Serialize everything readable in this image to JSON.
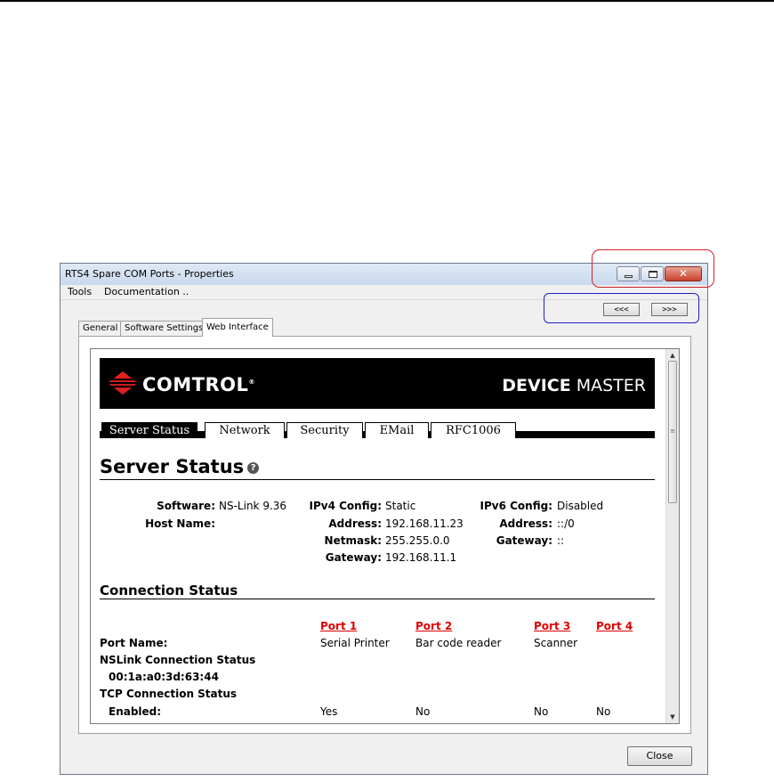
{
  "window": {
    "title": "RTS4 Spare COM Ports - Properties",
    "close_glyph": "✕"
  },
  "menu": {
    "items": [
      "Tools",
      "Documentation .."
    ]
  },
  "nav": {
    "back_label": "<<<",
    "forward_label": ">>>"
  },
  "tabs": [
    "General",
    "Software Settings",
    "Web Interface"
  ],
  "active_tab": "Web Interface",
  "web": {
    "brand": "COMTROL",
    "brand_mark": "®",
    "product_bold": "DEVICE",
    "product_rest": "MASTER",
    "tabs": [
      "Server Status",
      "Network",
      "Security",
      "EMail",
      "RFC1006"
    ],
    "active_tab": "Server Status",
    "server_status": {
      "heading": "Server Status",
      "help_glyph": "?",
      "software_label": "Software:",
      "software_value": "NS-Link 9.36",
      "host_label": "Host Name:",
      "ipv4_label": "IPv4 Config:",
      "ipv4_value": "Static",
      "address_label": "Address:",
      "address_value": "192.168.11.23",
      "netmask_label": "Netmask:",
      "netmask_value": "255.255.0.0",
      "gateway_label": "Gateway:",
      "gateway_value": "192.168.11.1",
      "ipv6_label": "IPv6 Config:",
      "ipv6_value": "Disabled",
      "ipv6_address_label": "Address:",
      "ipv6_address_value": "::/0",
      "ipv6_gateway_label": "Gateway:",
      "ipv6_gateway_value": "::"
    },
    "connection_status": {
      "heading": "Connection Status",
      "ports": [
        "Port 1",
        "Port 2",
        "Port 3",
        "Port 4"
      ],
      "port_name_label": "Port Name:",
      "port_names": [
        "Serial Printer",
        "Bar code reader",
        "Scanner",
        ""
      ],
      "nslink_label": "NSLink Connection Status",
      "mac": "00:1a:a0:3d:63:44",
      "tcp_label": "TCP Connection Status",
      "enabled_label": "Enabled:",
      "enabled_values": [
        "Yes",
        "No",
        "No",
        "No"
      ]
    }
  },
  "footer": {
    "close_label": "Close"
  },
  "colors": {
    "port_link": "#e00000",
    "highlight_red": "#d0202a",
    "highlight_blue": "#2020c0"
  }
}
